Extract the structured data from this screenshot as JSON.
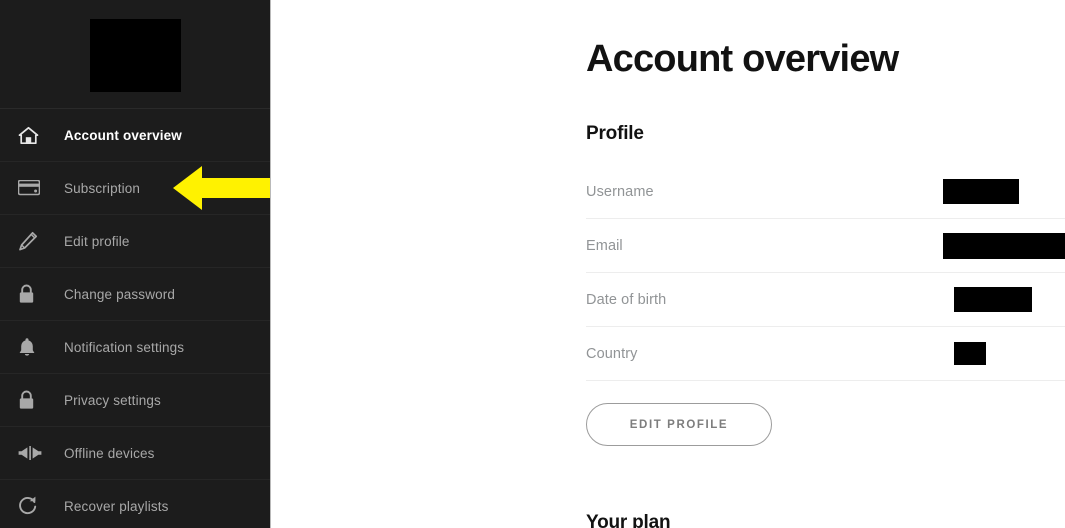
{
  "sidebar": {
    "logo_redacted": true,
    "items": [
      {
        "label": "Account overview",
        "icon": "home-icon",
        "active": true
      },
      {
        "label": "Subscription",
        "icon": "credit-card-icon",
        "active": false
      },
      {
        "label": "Edit profile",
        "icon": "pencil-icon",
        "active": false
      },
      {
        "label": "Change password",
        "icon": "lock-icon",
        "active": false
      },
      {
        "label": "Notification settings",
        "icon": "bell-icon",
        "active": false
      },
      {
        "label": "Privacy settings",
        "icon": "lock-icon",
        "active": false
      },
      {
        "label": "Offline devices",
        "icon": "offline-devices-icon",
        "active": false
      },
      {
        "label": "Recover playlists",
        "icon": "refresh-icon",
        "active": false
      }
    ]
  },
  "annotation": {
    "arrow": {
      "name": "yellow-pointer-arrow",
      "color": "#FFF200",
      "points_to": "Subscription",
      "direction": "left"
    }
  },
  "main": {
    "page_title": "Account overview",
    "profile": {
      "section_title": "Profile",
      "rows": [
        {
          "label": "Username",
          "value": "",
          "redacted": true,
          "redaction_width": 76,
          "redaction_height": 25
        },
        {
          "label": "Email",
          "value": "",
          "redacted": true,
          "redaction_width": 194,
          "redaction_height": 26
        },
        {
          "label": "Date of birth",
          "value": "",
          "redacted": true,
          "redaction_width": 78,
          "redaction_height": 25
        },
        {
          "label": "Country",
          "value": "",
          "redacted": true,
          "redaction_width": 32,
          "redaction_height": 23
        }
      ],
      "edit_button_label": "EDIT PROFILE"
    },
    "next_section_title": "Your plan"
  },
  "colors": {
    "sidebar_bg": "#1c1c1c",
    "sidebar_text": "#a8a8a8",
    "sidebar_text_active": "#ffffff",
    "accent_yellow": "#FFF200",
    "main_bg": "#ffffff",
    "heading": "#121212",
    "label_gray": "#919496",
    "divider": "#ededed",
    "redaction": "#000000"
  }
}
